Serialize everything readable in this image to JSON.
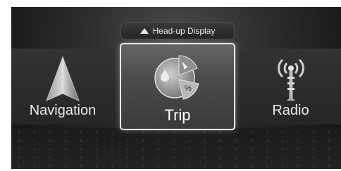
{
  "header": {
    "hud_label": "Head-up Display",
    "hud_icon": "up-triangle-icon"
  },
  "menu": {
    "items": [
      {
        "label": "Navigation",
        "icon": "navigation-arrow-icon",
        "selected": false
      },
      {
        "label": "Trip",
        "icon": "trip-pie-icon",
        "selected": true
      },
      {
        "label": "Radio",
        "icon": "radio-antenna-icon",
        "selected": false
      }
    ]
  },
  "colors": {
    "background": "#1a1a1a",
    "selected_border": "#e8e8e8",
    "text": "#eaeaea"
  }
}
